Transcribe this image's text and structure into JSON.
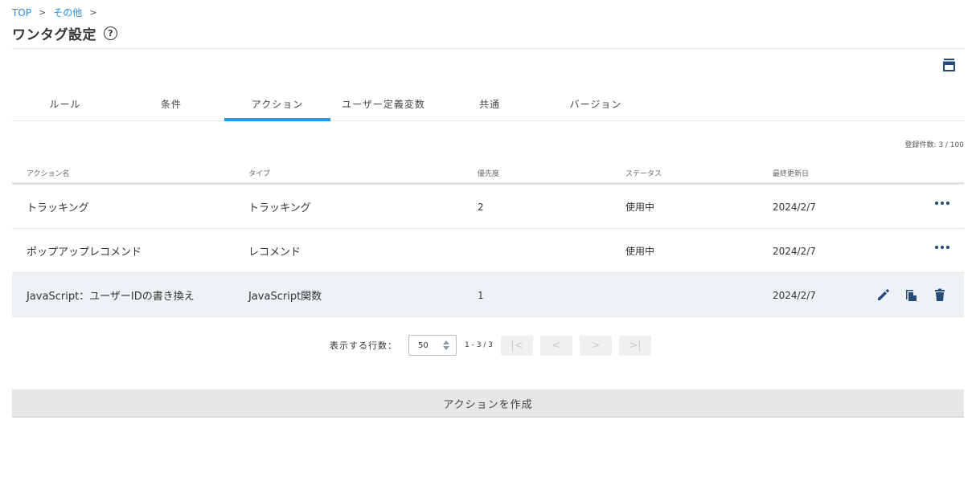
{
  "breadcrumb": {
    "items": [
      "TOP",
      "その他"
    ],
    "separator": ">"
  },
  "page": {
    "title": "ワンタグ設定",
    "help_icon": "?"
  },
  "tabs": [
    "ルール",
    "条件",
    "アクション",
    "ユーザー定義変数",
    "共通",
    "バージョン"
  ],
  "active_tab": "アクション",
  "record_count": "登録件数: 3 / 100",
  "table": {
    "columns": [
      "アクション名",
      "タイプ",
      "優先度",
      "ステータス",
      "最終更新日"
    ],
    "rows": [
      {
        "name": "トラッキング",
        "type": "トラッキング",
        "priority": "2",
        "status": "使用中",
        "updated": "2024/2/7"
      },
      {
        "name": "ポップアップレコメンド",
        "type": "レコメンド",
        "priority": "",
        "status": "使用中",
        "updated": "2024/2/7"
      },
      {
        "name": "JavaScript：ユーザーIDの書き換え",
        "type": "JavaScript関数",
        "priority": "1",
        "status": "",
        "updated": "2024/2/7"
      }
    ]
  },
  "pagination": {
    "rows_label": "表示する行数：",
    "rows_value": "50",
    "range": "1 - 3 / 3",
    "first": "|<",
    "prev": "<",
    "next": ">",
    "last": ">|"
  },
  "create_button": "アクションを作成",
  "colors": {
    "accent": "#2c96e8",
    "icon": "#244a78",
    "link": "#2a8ee0"
  },
  "icons": [
    "help-icon",
    "archive-icon",
    "more-icon",
    "edit-icon",
    "copy-icon",
    "delete-icon",
    "spinner-icon"
  ]
}
